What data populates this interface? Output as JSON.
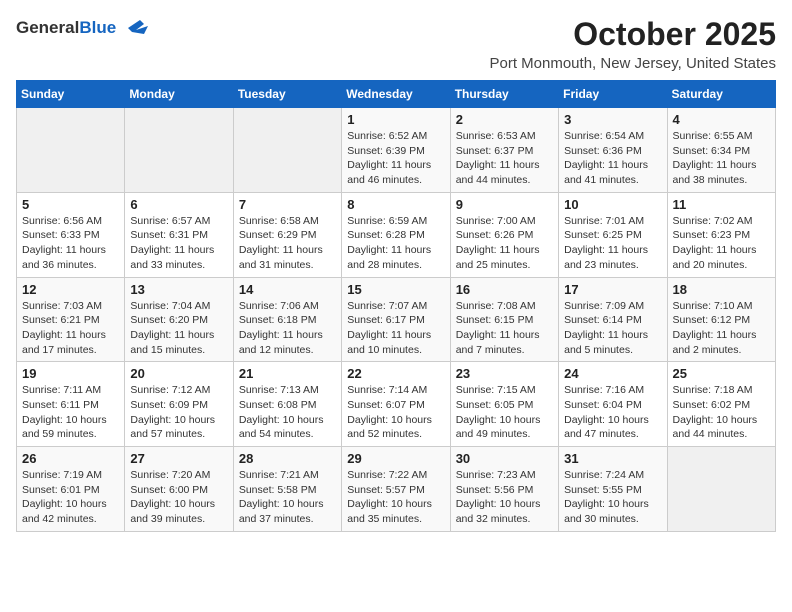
{
  "header": {
    "logo_general": "General",
    "logo_blue": "Blue",
    "month_title": "October 2025",
    "location": "Port Monmouth, New Jersey, United States"
  },
  "days_of_week": [
    "Sunday",
    "Monday",
    "Tuesday",
    "Wednesday",
    "Thursday",
    "Friday",
    "Saturday"
  ],
  "weeks": [
    [
      {
        "day": "",
        "detail": ""
      },
      {
        "day": "",
        "detail": ""
      },
      {
        "day": "",
        "detail": ""
      },
      {
        "day": "1",
        "detail": "Sunrise: 6:52 AM\nSunset: 6:39 PM\nDaylight: 11 hours\nand 46 minutes."
      },
      {
        "day": "2",
        "detail": "Sunrise: 6:53 AM\nSunset: 6:37 PM\nDaylight: 11 hours\nand 44 minutes."
      },
      {
        "day": "3",
        "detail": "Sunrise: 6:54 AM\nSunset: 6:36 PM\nDaylight: 11 hours\nand 41 minutes."
      },
      {
        "day": "4",
        "detail": "Sunrise: 6:55 AM\nSunset: 6:34 PM\nDaylight: 11 hours\nand 38 minutes."
      }
    ],
    [
      {
        "day": "5",
        "detail": "Sunrise: 6:56 AM\nSunset: 6:33 PM\nDaylight: 11 hours\nand 36 minutes."
      },
      {
        "day": "6",
        "detail": "Sunrise: 6:57 AM\nSunset: 6:31 PM\nDaylight: 11 hours\nand 33 minutes."
      },
      {
        "day": "7",
        "detail": "Sunrise: 6:58 AM\nSunset: 6:29 PM\nDaylight: 11 hours\nand 31 minutes."
      },
      {
        "day": "8",
        "detail": "Sunrise: 6:59 AM\nSunset: 6:28 PM\nDaylight: 11 hours\nand 28 minutes."
      },
      {
        "day": "9",
        "detail": "Sunrise: 7:00 AM\nSunset: 6:26 PM\nDaylight: 11 hours\nand 25 minutes."
      },
      {
        "day": "10",
        "detail": "Sunrise: 7:01 AM\nSunset: 6:25 PM\nDaylight: 11 hours\nand 23 minutes."
      },
      {
        "day": "11",
        "detail": "Sunrise: 7:02 AM\nSunset: 6:23 PM\nDaylight: 11 hours\nand 20 minutes."
      }
    ],
    [
      {
        "day": "12",
        "detail": "Sunrise: 7:03 AM\nSunset: 6:21 PM\nDaylight: 11 hours\nand 17 minutes."
      },
      {
        "day": "13",
        "detail": "Sunrise: 7:04 AM\nSunset: 6:20 PM\nDaylight: 11 hours\nand 15 minutes."
      },
      {
        "day": "14",
        "detail": "Sunrise: 7:06 AM\nSunset: 6:18 PM\nDaylight: 11 hours\nand 12 minutes."
      },
      {
        "day": "15",
        "detail": "Sunrise: 7:07 AM\nSunset: 6:17 PM\nDaylight: 11 hours\nand 10 minutes."
      },
      {
        "day": "16",
        "detail": "Sunrise: 7:08 AM\nSunset: 6:15 PM\nDaylight: 11 hours\nand 7 minutes."
      },
      {
        "day": "17",
        "detail": "Sunrise: 7:09 AM\nSunset: 6:14 PM\nDaylight: 11 hours\nand 5 minutes."
      },
      {
        "day": "18",
        "detail": "Sunrise: 7:10 AM\nSunset: 6:12 PM\nDaylight: 11 hours\nand 2 minutes."
      }
    ],
    [
      {
        "day": "19",
        "detail": "Sunrise: 7:11 AM\nSunset: 6:11 PM\nDaylight: 10 hours\nand 59 minutes."
      },
      {
        "day": "20",
        "detail": "Sunrise: 7:12 AM\nSunset: 6:09 PM\nDaylight: 10 hours\nand 57 minutes."
      },
      {
        "day": "21",
        "detail": "Sunrise: 7:13 AM\nSunset: 6:08 PM\nDaylight: 10 hours\nand 54 minutes."
      },
      {
        "day": "22",
        "detail": "Sunrise: 7:14 AM\nSunset: 6:07 PM\nDaylight: 10 hours\nand 52 minutes."
      },
      {
        "day": "23",
        "detail": "Sunrise: 7:15 AM\nSunset: 6:05 PM\nDaylight: 10 hours\nand 49 minutes."
      },
      {
        "day": "24",
        "detail": "Sunrise: 7:16 AM\nSunset: 6:04 PM\nDaylight: 10 hours\nand 47 minutes."
      },
      {
        "day": "25",
        "detail": "Sunrise: 7:18 AM\nSunset: 6:02 PM\nDaylight: 10 hours\nand 44 minutes."
      }
    ],
    [
      {
        "day": "26",
        "detail": "Sunrise: 7:19 AM\nSunset: 6:01 PM\nDaylight: 10 hours\nand 42 minutes."
      },
      {
        "day": "27",
        "detail": "Sunrise: 7:20 AM\nSunset: 6:00 PM\nDaylight: 10 hours\nand 39 minutes."
      },
      {
        "day": "28",
        "detail": "Sunrise: 7:21 AM\nSunset: 5:58 PM\nDaylight: 10 hours\nand 37 minutes."
      },
      {
        "day": "29",
        "detail": "Sunrise: 7:22 AM\nSunset: 5:57 PM\nDaylight: 10 hours\nand 35 minutes."
      },
      {
        "day": "30",
        "detail": "Sunrise: 7:23 AM\nSunset: 5:56 PM\nDaylight: 10 hours\nand 32 minutes."
      },
      {
        "day": "31",
        "detail": "Sunrise: 7:24 AM\nSunset: 5:55 PM\nDaylight: 10 hours\nand 30 minutes."
      },
      {
        "day": "",
        "detail": ""
      }
    ]
  ]
}
